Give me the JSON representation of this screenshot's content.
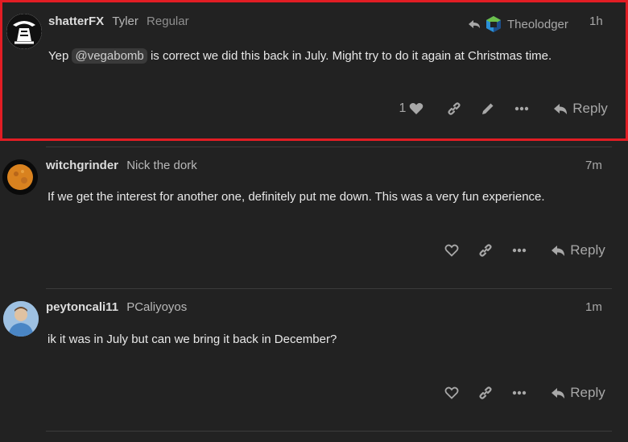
{
  "posts": [
    {
      "username": "shatterFX",
      "fullname": "Tyler",
      "user_title": "Regular",
      "age": "1h",
      "reply_to_user": "Theolodger",
      "text_before": "Yep",
      "mention": "@vegabomb",
      "text_after": "is correct we did this back in July. Might try to do it again at Christmas time.",
      "like_count": "1",
      "reply_label": "Reply"
    },
    {
      "username": "witchgrinder",
      "fullname": "Nick the dork",
      "age": "7m",
      "text": "If we get the interest for another one, definitely put me down. This was a very fun experience.",
      "reply_label": "Reply"
    },
    {
      "username": "peytoncali11",
      "fullname": "PCaliyoyos",
      "age": "1m",
      "text": "ik it was in July but can we bring it back in December?",
      "reply_label": "Reply"
    }
  ],
  "colors": {
    "background": "#222222",
    "highlight_border": "#e21d24",
    "text": "#dddddd",
    "muted": "#a8a8a8"
  },
  "icons": [
    "heart-icon",
    "link-icon",
    "pencil-icon",
    "more-icon",
    "reply-icon",
    "reply-arrow-icon"
  ]
}
